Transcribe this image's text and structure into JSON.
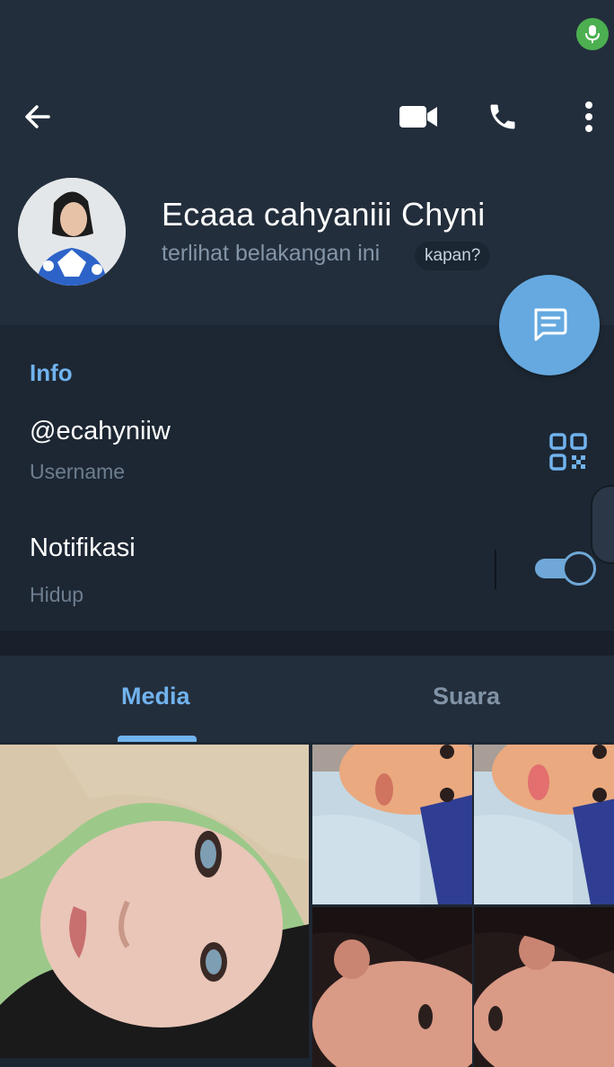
{
  "status_bar": {
    "mic_icon": "microphone-icon",
    "mic_color": "#4caf50"
  },
  "top_bar": {
    "back_icon": "arrow-left-icon",
    "video_icon": "video-camera-icon",
    "call_icon": "phone-icon",
    "menu_icon": "more-vertical-icon"
  },
  "profile": {
    "name": "Ecaaa cahyaniii Chyni",
    "last_seen": "terlihat belakangan ini",
    "last_seen_badge": "kapan?"
  },
  "fab": {
    "icon": "message-icon",
    "color": "#65a9e0"
  },
  "info": {
    "title": "Info",
    "username": "@ecahyniiw",
    "username_label": "Username",
    "qr_icon": "qr-code-icon",
    "notifications_label": "Notifikasi",
    "notifications_value": "Hidup",
    "notifications_enabled": true
  },
  "tabs": [
    {
      "label": "Media",
      "active": true
    },
    {
      "label": "Suara",
      "active": false
    }
  ],
  "colors": {
    "accent": "#71b3ee",
    "background": "#1d2733",
    "header": "#232e3c"
  }
}
